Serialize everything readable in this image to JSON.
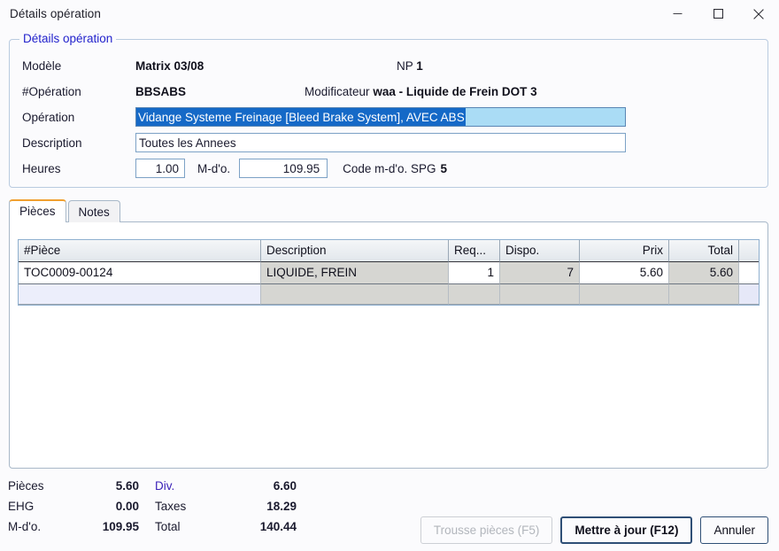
{
  "window": {
    "title": "Détails opération",
    "controls": {
      "minimize": "minimize-icon",
      "maximize": "maximize-icon",
      "close": "close-icon"
    }
  },
  "groupbox": {
    "legend": "Détails opération",
    "fields": {
      "modele_label": "Modèle",
      "modele_value": "Matrix 03/08",
      "np_label": "NP",
      "np_value": "1",
      "operation_num_label": "#Opération",
      "operation_num_value": "BBSABS",
      "modificateur_label": "Modificateur",
      "modificateur_value": "waa - Liquide de Frein DOT 3",
      "operation_label": "Opération",
      "operation_value": "Vidange Systeme Freinage [Bleed Brake System], AVEC ABS",
      "description_label": "Description",
      "description_value": "Toutes les Annees",
      "heures_label": "Heures",
      "heures_value": "1.00",
      "mdo_label": "M-d'o.",
      "mdo_value": "109.95",
      "code_mdo_label": "Code m-d'o. SPG",
      "code_mdo_value": "5"
    }
  },
  "tabs": [
    {
      "label": "Pièces",
      "active": true
    },
    {
      "label": "Notes",
      "active": false
    }
  ],
  "grid": {
    "columns": [
      "#Pièce",
      "Description",
      "Req...",
      "Dispo.",
      "Prix",
      "Total",
      ""
    ],
    "rows": [
      {
        "piece": "TOC0009-00124",
        "description": "LIQUIDE, FREIN",
        "req": "1",
        "dispo": "7",
        "prix": "5.60",
        "total": "5.60",
        "extra": ""
      }
    ],
    "new_row": {
      "piece": "",
      "description": "",
      "req": "",
      "dispo": "",
      "prix": "",
      "total": "",
      "extra": "",
      "search_icon": "search-icon"
    }
  },
  "totals": {
    "pieces_label": "Pièces",
    "pieces_value": "5.60",
    "div_label": "Div.",
    "div_value": "6.60",
    "ehg_label": "EHG",
    "ehg_value": "0.00",
    "taxes_label": "Taxes",
    "taxes_value": "18.29",
    "mdo_label": "M-d'o.",
    "mdo_value": "109.95",
    "total_label": "Total",
    "total_value": "140.44"
  },
  "buttons": {
    "trousse": "Trousse pièces (F5)",
    "update": "Mettre à jour (F12)",
    "cancel": "Annuler"
  },
  "colors": {
    "accent_tab": "#f0a030",
    "legend": "#2222cc",
    "selection_bg": "#1569c7",
    "field_bg": "#aadcf5",
    "link": "#3b22b8"
  }
}
